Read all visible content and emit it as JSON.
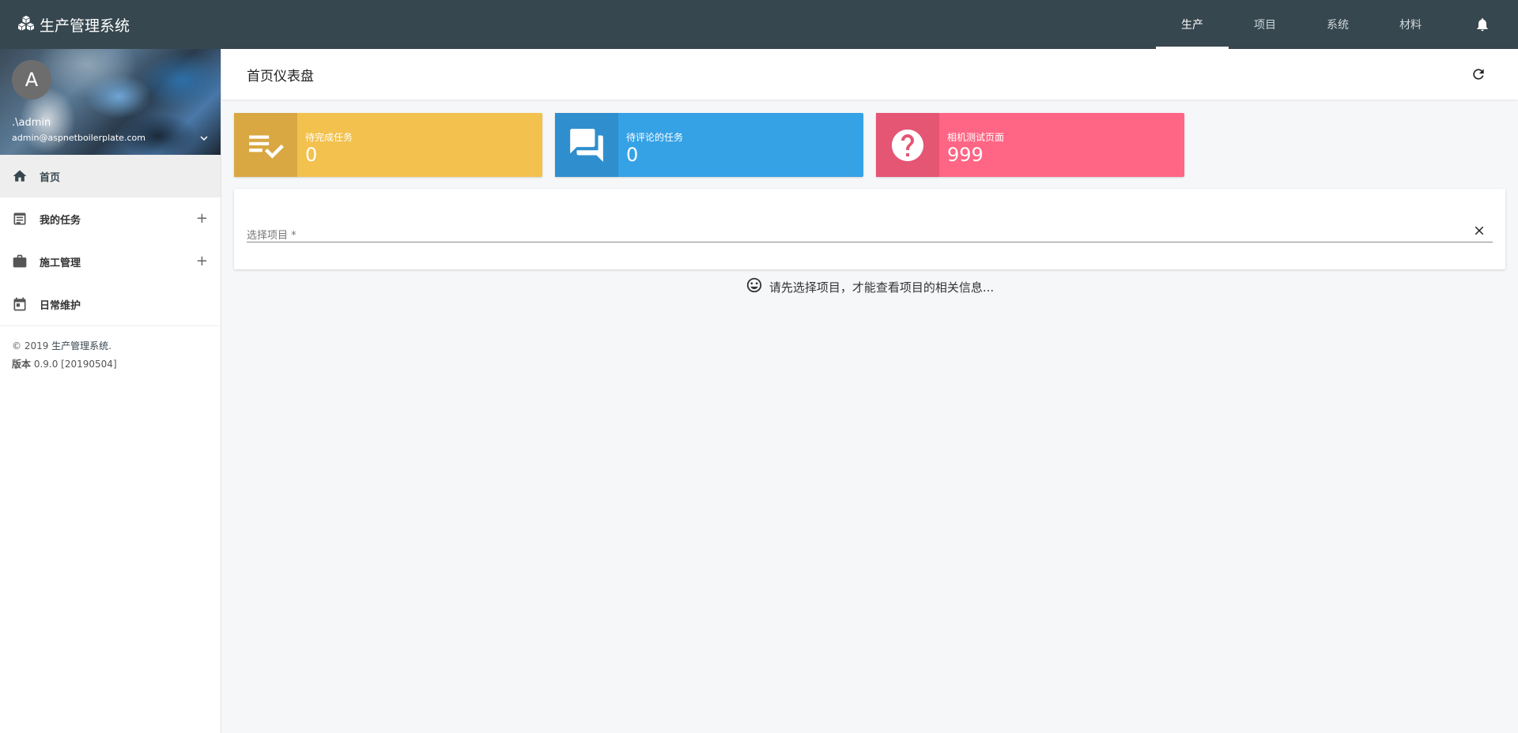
{
  "app": {
    "title": "生产管理系统",
    "icon": "cubes-icon"
  },
  "topnav": {
    "tabs": [
      {
        "label": "生产",
        "active": true
      },
      {
        "label": "项目",
        "active": false
      },
      {
        "label": "系统",
        "active": false
      },
      {
        "label": "材料",
        "active": false
      }
    ],
    "bell_icon": "bell-icon"
  },
  "user": {
    "avatar_letter": "A",
    "name": ".\\admin",
    "email": "admin@aspnetboilerplate.com"
  },
  "sidebar": {
    "items": [
      {
        "label": "首页",
        "icon": "home-icon",
        "expandable": false,
        "active": true
      },
      {
        "label": "我的任务",
        "icon": "assignment-icon",
        "expandable": true,
        "active": false
      },
      {
        "label": "施工管理",
        "icon": "briefcase-icon",
        "expandable": true,
        "active": false
      },
      {
        "label": "日常维护",
        "icon": "calendar-icon",
        "expandable": false,
        "active": false
      }
    ],
    "footer": {
      "copyright_prefix": "© 2019 ",
      "brand": "生产管理系统",
      "copyright_suffix": ".",
      "version_label": "版本",
      "version_value": " 0.9.0 [20190504]"
    }
  },
  "page": {
    "title": "首页仪表盘",
    "refresh_icon": "refresh-icon"
  },
  "cards": [
    {
      "label": "待完成任务",
      "value": "0",
      "icon": "playlist-check-icon",
      "color": "#f2c14e",
      "icon_bg": "#d9a843"
    },
    {
      "label": "待评论的任务",
      "value": "0",
      "icon": "forum-icon",
      "color": "#36a2e6",
      "icon_bg": "#2f8fce"
    },
    {
      "label": "相机测试页面",
      "value": "999",
      "icon": "help-circle-icon",
      "color": "#ff6584",
      "icon_bg": "#e55574"
    }
  ],
  "project_select": {
    "placeholder": "选择项目 *"
  },
  "hint": {
    "text": "请先选择项目，才能查看项目的相关信息..."
  },
  "colors": {
    "topbar": "#37474f",
    "background": "#f6f7f9"
  }
}
